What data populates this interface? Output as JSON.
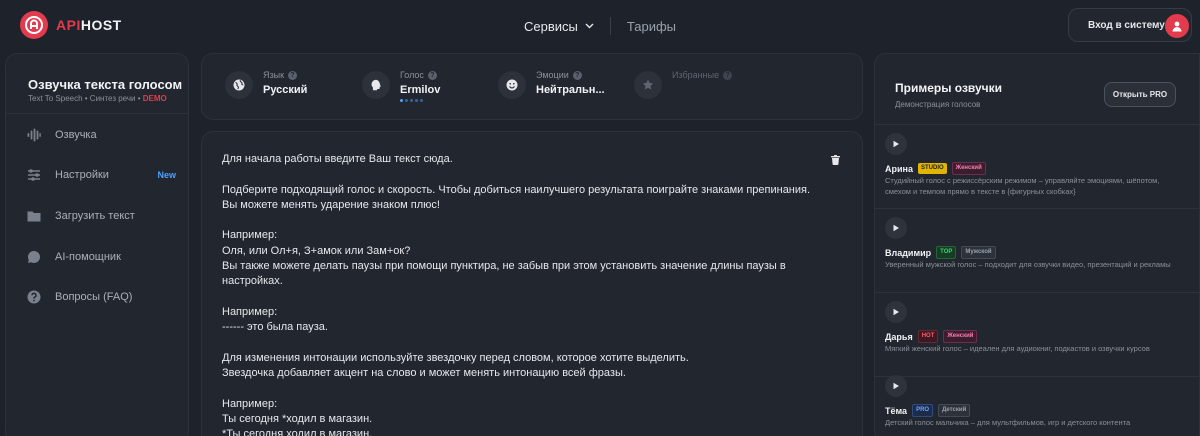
{
  "header": {
    "logo_api": "API",
    "logo_host": "HOST",
    "nav": [
      {
        "label": "Сервисы"
      },
      {
        "label": "Тарифы"
      }
    ],
    "login_label": "Вход в систему"
  },
  "sidebar": {
    "title": "Озвучка текста голосом",
    "subtitle": "Text To Speech • Синтез речи •",
    "demo": "DEMO",
    "items": [
      {
        "label": "Озвучка",
        "icon": "waveform-icon"
      },
      {
        "label": "Настройки",
        "icon": "sliders-icon",
        "badge": "New"
      },
      {
        "label": "Загрузить текст",
        "icon": "folder-icon"
      },
      {
        "label": "AI-помощник",
        "icon": "chat-icon"
      },
      {
        "label": "Вопросы (FAQ)",
        "icon": "question-icon"
      }
    ]
  },
  "params": [
    {
      "label": "Язык",
      "value": "Русский",
      "icon": "globe-icon"
    },
    {
      "label": "Голос",
      "value": "Ermilov",
      "icon": "head-icon"
    },
    {
      "label": "Эмоции",
      "value": "Нейтральн...",
      "icon": "smile-icon"
    },
    {
      "label": "Избранные",
      "value": "",
      "icon": "star-icon"
    }
  ],
  "editor": {
    "text": "Для начала работы введите Ваш текст сюда.\n\nПодберите подходящий голос и скорость. Чтобы добиться наилучшего результата поиграйте знаками препинания.\nВы можете менять ударение знаком плюс!\n\nНапример:\nОля, или Ол+я, З+амок или Зам+ок?\nВы также можете делать паузы при помощи пунктира, не забыв при этом установить значение длины паузы в настройках.\n\nНапример:\n------ это была пауза.\n\nДля изменения интонации используйте звездочку перед словом, которое хотите выделить.\nЗвездочка добавляет акцент на слово и может менять интонацию всей фразы.\n\nНапример:\nТы сегодня *ходил в магазин.\n*Ты сегодня ходил в магазин."
  },
  "examples": {
    "title": "Примеры озвучки",
    "subtitle": "Демонстрация голосов",
    "pro_button": "Открыть PRO",
    "voices": [
      {
        "name": "Арина",
        "tag": "STUDIO",
        "gender": "Женский",
        "desc": "Студийный голос с режиссёрским режимом – управляйте эмоциями, шёпотом, смехом и темпом прямо в тексте в {фигурных скобках}"
      },
      {
        "name": "Владимир",
        "tag": "TOP",
        "gender": "Мужской",
        "desc": "Уверенный мужской голос – подходит для озвучки видео, презентаций и рекламы"
      },
      {
        "name": "Дарья",
        "tag": "HOT",
        "gender": "Женский",
        "desc": "Мягкий женский голос – идеален для аудиокниг, подкастов и озвучки курсов"
      },
      {
        "name": "Тёма",
        "tag": "PRO",
        "gender": "Детский",
        "desc": "Детский голос мальчика – для мультфильмов, игр и детского контента"
      }
    ]
  },
  "colors": {
    "accent": "#e23b4e",
    "link": "#4aa3ff",
    "background": "#1e222a",
    "panel": "#22262e"
  }
}
